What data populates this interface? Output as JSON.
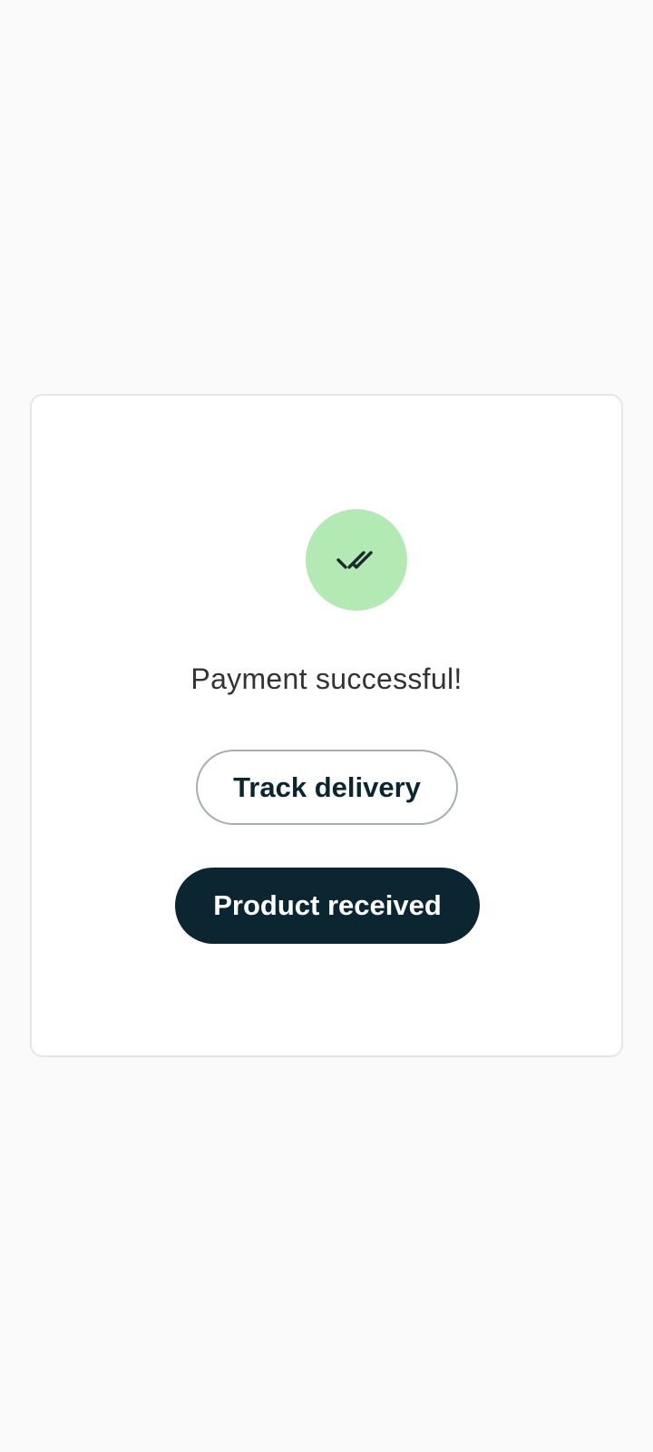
{
  "colors": {
    "page_background": "#fafafa",
    "card_background": "#ffffff",
    "success_circle": "#b3e9b2",
    "primary_dark": "#0b2630",
    "title_text": "#333333"
  },
  "status": {
    "icon": "double-check-icon",
    "message": "Payment successful!"
  },
  "actions": {
    "track_delivery_label": "Track delivery",
    "product_received_label": "Product received"
  }
}
